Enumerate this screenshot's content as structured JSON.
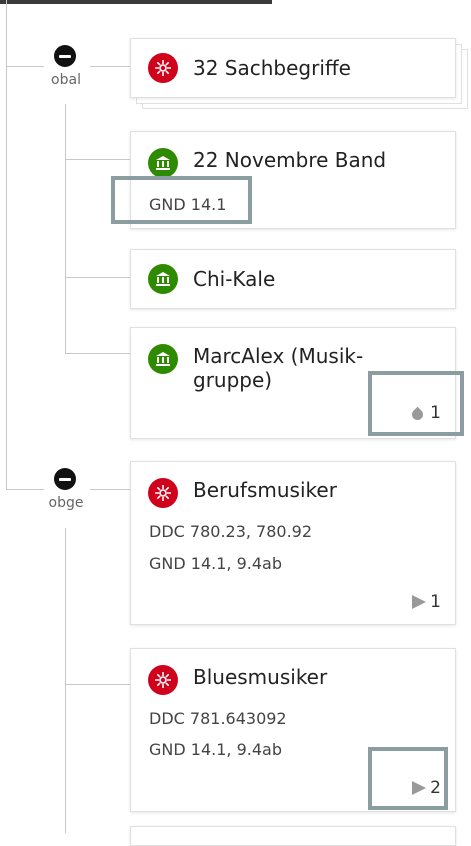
{
  "nodes": [
    {
      "label": "obal"
    },
    {
      "label": "obge"
    }
  ],
  "cards": [
    {
      "title": "32 Sachbegriffe",
      "icon": "subject-icon",
      "color": "#d0021b"
    },
    {
      "title": "22 Novembre Band",
      "icon": "corporate-icon",
      "color": "#2e8b00",
      "line1": "GND 14.1"
    },
    {
      "title": "Chi-Kale",
      "icon": "corporate-icon",
      "color": "#2e8b00"
    },
    {
      "title": "MarcAlex (Musik-gruppe)",
      "icon": "corporate-icon",
      "color": "#2e8b00",
      "badge": "1",
      "badge_icon": "drop-icon"
    },
    {
      "title": "Berufsmusiker",
      "icon": "subject-icon",
      "color": "#d0021b",
      "line1": "DDC 780.23, 780.92",
      "line2": "GND 14.1, 9.4ab",
      "badge": "1",
      "badge_icon": "triangle-right-icon"
    },
    {
      "title": "Bluesmusiker",
      "icon": "subject-icon",
      "color": "#d0021b",
      "line1": "DDC 781.643092",
      "line2": "GND 14.1, 9.4ab",
      "badge": "2",
      "badge_icon": "triangle-right-icon"
    }
  ]
}
